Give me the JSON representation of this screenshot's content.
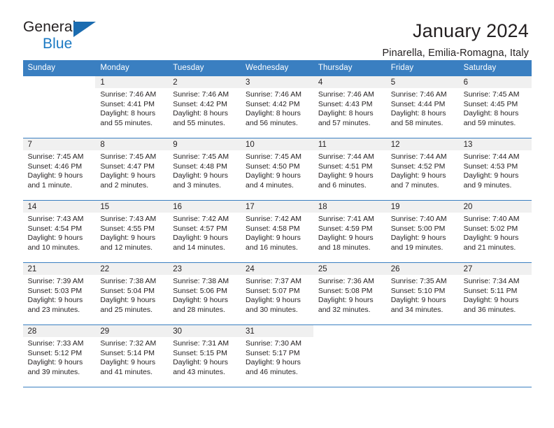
{
  "logo": {
    "word_one": "General",
    "word_two": "Blue",
    "triangle_icon": "triangle-icon",
    "blue": "#1b79c3"
  },
  "header": {
    "title": "January 2024",
    "subtitle": "Pinarella, Emilia-Romagna, Italy"
  },
  "calendar": {
    "accent_color": "#3a7fc1",
    "daynum_band_color": "#f0f0f0",
    "weekday_headers": [
      "Sunday",
      "Monday",
      "Tuesday",
      "Wednesday",
      "Thursday",
      "Friday",
      "Saturday"
    ],
    "weeks": [
      [
        {
          "day": ""
        },
        {
          "day": "1",
          "sunrise": "Sunrise: 7:46 AM",
          "sunset": "Sunset: 4:41 PM",
          "daylight": "Daylight: 8 hours and 55 minutes."
        },
        {
          "day": "2",
          "sunrise": "Sunrise: 7:46 AM",
          "sunset": "Sunset: 4:42 PM",
          "daylight": "Daylight: 8 hours and 55 minutes."
        },
        {
          "day": "3",
          "sunrise": "Sunrise: 7:46 AM",
          "sunset": "Sunset: 4:42 PM",
          "daylight": "Daylight: 8 hours and 56 minutes."
        },
        {
          "day": "4",
          "sunrise": "Sunrise: 7:46 AM",
          "sunset": "Sunset: 4:43 PM",
          "daylight": "Daylight: 8 hours and 57 minutes."
        },
        {
          "day": "5",
          "sunrise": "Sunrise: 7:46 AM",
          "sunset": "Sunset: 4:44 PM",
          "daylight": "Daylight: 8 hours and 58 minutes."
        },
        {
          "day": "6",
          "sunrise": "Sunrise: 7:45 AM",
          "sunset": "Sunset: 4:45 PM",
          "daylight": "Daylight: 8 hours and 59 minutes."
        }
      ],
      [
        {
          "day": "7",
          "sunrise": "Sunrise: 7:45 AM",
          "sunset": "Sunset: 4:46 PM",
          "daylight": "Daylight: 9 hours and 1 minute."
        },
        {
          "day": "8",
          "sunrise": "Sunrise: 7:45 AM",
          "sunset": "Sunset: 4:47 PM",
          "daylight": "Daylight: 9 hours and 2 minutes."
        },
        {
          "day": "9",
          "sunrise": "Sunrise: 7:45 AM",
          "sunset": "Sunset: 4:48 PM",
          "daylight": "Daylight: 9 hours and 3 minutes."
        },
        {
          "day": "10",
          "sunrise": "Sunrise: 7:45 AM",
          "sunset": "Sunset: 4:50 PM",
          "daylight": "Daylight: 9 hours and 4 minutes."
        },
        {
          "day": "11",
          "sunrise": "Sunrise: 7:44 AM",
          "sunset": "Sunset: 4:51 PM",
          "daylight": "Daylight: 9 hours and 6 minutes."
        },
        {
          "day": "12",
          "sunrise": "Sunrise: 7:44 AM",
          "sunset": "Sunset: 4:52 PM",
          "daylight": "Daylight: 9 hours and 7 minutes."
        },
        {
          "day": "13",
          "sunrise": "Sunrise: 7:44 AM",
          "sunset": "Sunset: 4:53 PM",
          "daylight": "Daylight: 9 hours and 9 minutes."
        }
      ],
      [
        {
          "day": "14",
          "sunrise": "Sunrise: 7:43 AM",
          "sunset": "Sunset: 4:54 PM",
          "daylight": "Daylight: 9 hours and 10 minutes."
        },
        {
          "day": "15",
          "sunrise": "Sunrise: 7:43 AM",
          "sunset": "Sunset: 4:55 PM",
          "daylight": "Daylight: 9 hours and 12 minutes."
        },
        {
          "day": "16",
          "sunrise": "Sunrise: 7:42 AM",
          "sunset": "Sunset: 4:57 PM",
          "daylight": "Daylight: 9 hours and 14 minutes."
        },
        {
          "day": "17",
          "sunrise": "Sunrise: 7:42 AM",
          "sunset": "Sunset: 4:58 PM",
          "daylight": "Daylight: 9 hours and 16 minutes."
        },
        {
          "day": "18",
          "sunrise": "Sunrise: 7:41 AM",
          "sunset": "Sunset: 4:59 PM",
          "daylight": "Daylight: 9 hours and 18 minutes."
        },
        {
          "day": "19",
          "sunrise": "Sunrise: 7:40 AM",
          "sunset": "Sunset: 5:00 PM",
          "daylight": "Daylight: 9 hours and 19 minutes."
        },
        {
          "day": "20",
          "sunrise": "Sunrise: 7:40 AM",
          "sunset": "Sunset: 5:02 PM",
          "daylight": "Daylight: 9 hours and 21 minutes."
        }
      ],
      [
        {
          "day": "21",
          "sunrise": "Sunrise: 7:39 AM",
          "sunset": "Sunset: 5:03 PM",
          "daylight": "Daylight: 9 hours and 23 minutes."
        },
        {
          "day": "22",
          "sunrise": "Sunrise: 7:38 AM",
          "sunset": "Sunset: 5:04 PM",
          "daylight": "Daylight: 9 hours and 25 minutes."
        },
        {
          "day": "23",
          "sunrise": "Sunrise: 7:38 AM",
          "sunset": "Sunset: 5:06 PM",
          "daylight": "Daylight: 9 hours and 28 minutes."
        },
        {
          "day": "24",
          "sunrise": "Sunrise: 7:37 AM",
          "sunset": "Sunset: 5:07 PM",
          "daylight": "Daylight: 9 hours and 30 minutes."
        },
        {
          "day": "25",
          "sunrise": "Sunrise: 7:36 AM",
          "sunset": "Sunset: 5:08 PM",
          "daylight": "Daylight: 9 hours and 32 minutes."
        },
        {
          "day": "26",
          "sunrise": "Sunrise: 7:35 AM",
          "sunset": "Sunset: 5:10 PM",
          "daylight": "Daylight: 9 hours and 34 minutes."
        },
        {
          "day": "27",
          "sunrise": "Sunrise: 7:34 AM",
          "sunset": "Sunset: 5:11 PM",
          "daylight": "Daylight: 9 hours and 36 minutes."
        }
      ],
      [
        {
          "day": "28",
          "sunrise": "Sunrise: 7:33 AM",
          "sunset": "Sunset: 5:12 PM",
          "daylight": "Daylight: 9 hours and 39 minutes."
        },
        {
          "day": "29",
          "sunrise": "Sunrise: 7:32 AM",
          "sunset": "Sunset: 5:14 PM",
          "daylight": "Daylight: 9 hours and 41 minutes."
        },
        {
          "day": "30",
          "sunrise": "Sunrise: 7:31 AM",
          "sunset": "Sunset: 5:15 PM",
          "daylight": "Daylight: 9 hours and 43 minutes."
        },
        {
          "day": "31",
          "sunrise": "Sunrise: 7:30 AM",
          "sunset": "Sunset: 5:17 PM",
          "daylight": "Daylight: 9 hours and 46 minutes."
        },
        {
          "day": ""
        },
        {
          "day": ""
        },
        {
          "day": ""
        }
      ]
    ]
  }
}
